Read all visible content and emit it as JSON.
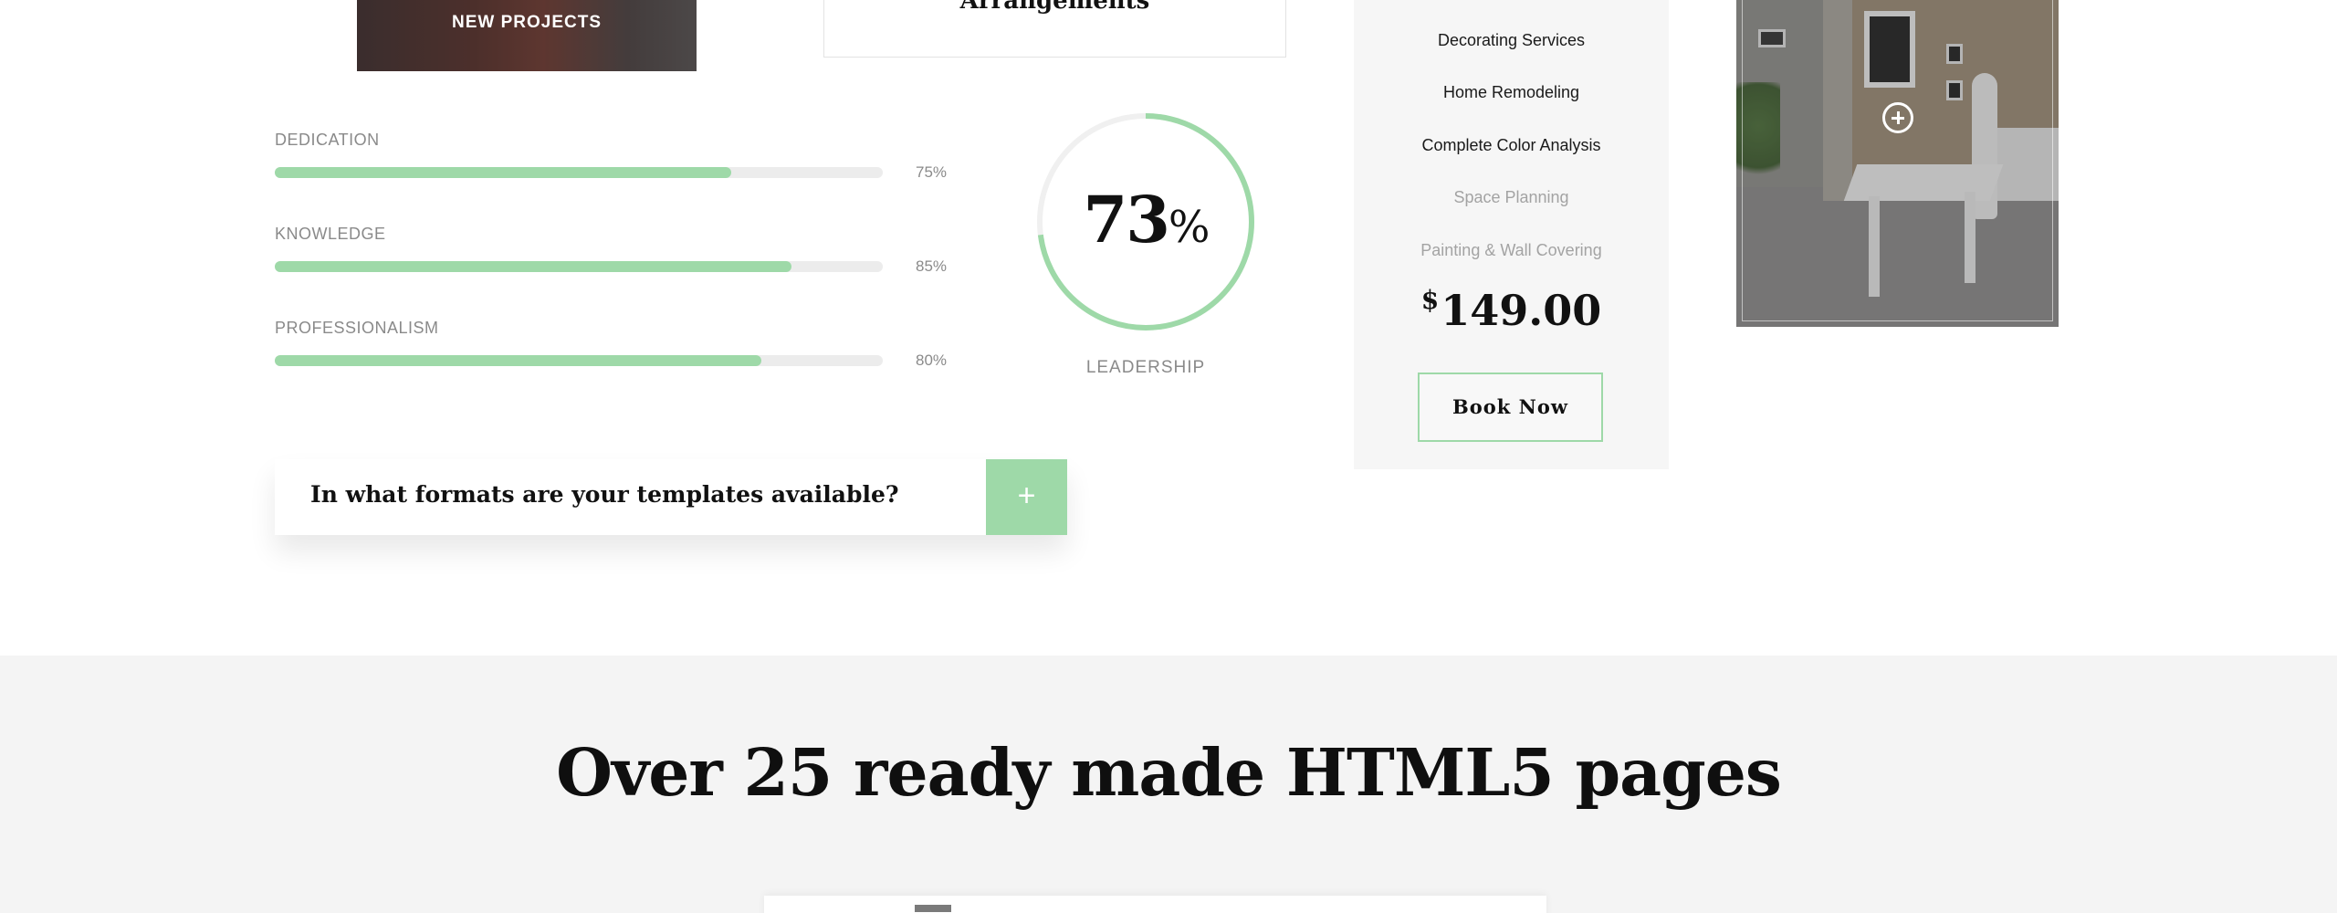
{
  "project_tile": {
    "label": "NEW PROJECTS"
  },
  "arrangements": {
    "title": "Arrangements"
  },
  "skills": [
    {
      "name": "DEDICATION",
      "percent_label": "75%",
      "value": 75
    },
    {
      "name": "KNOWLEDGE",
      "percent_label": "85%",
      "value": 85
    },
    {
      "name": "PROFESSIONALISM",
      "percent_label": "80%",
      "value": 80
    }
  ],
  "leadership": {
    "value": "73",
    "unit": "%",
    "label": "LEADERSHIP",
    "progress": 73
  },
  "pricing": {
    "items": [
      {
        "label": "Decorating Services",
        "state": "active"
      },
      {
        "label": "Home Remodeling",
        "state": "active"
      },
      {
        "label": "Complete Color Analysis",
        "state": "active"
      },
      {
        "label": "Space Planning",
        "state": "muted"
      },
      {
        "label": "Painting & Wall Covering",
        "state": "muted"
      }
    ],
    "currency": "$",
    "price": "149.00",
    "book_label": "Book Now"
  },
  "faq": {
    "question": "In what formats are your templates available?",
    "toggle": "+"
  },
  "section": {
    "heading": "Over 25 ready made HTML5 pages"
  },
  "colors": {
    "accent": "#9ed9a8",
    "track": "#ececec",
    "panel": "#f6f6f6",
    "section_bg": "#f4f4f4"
  }
}
